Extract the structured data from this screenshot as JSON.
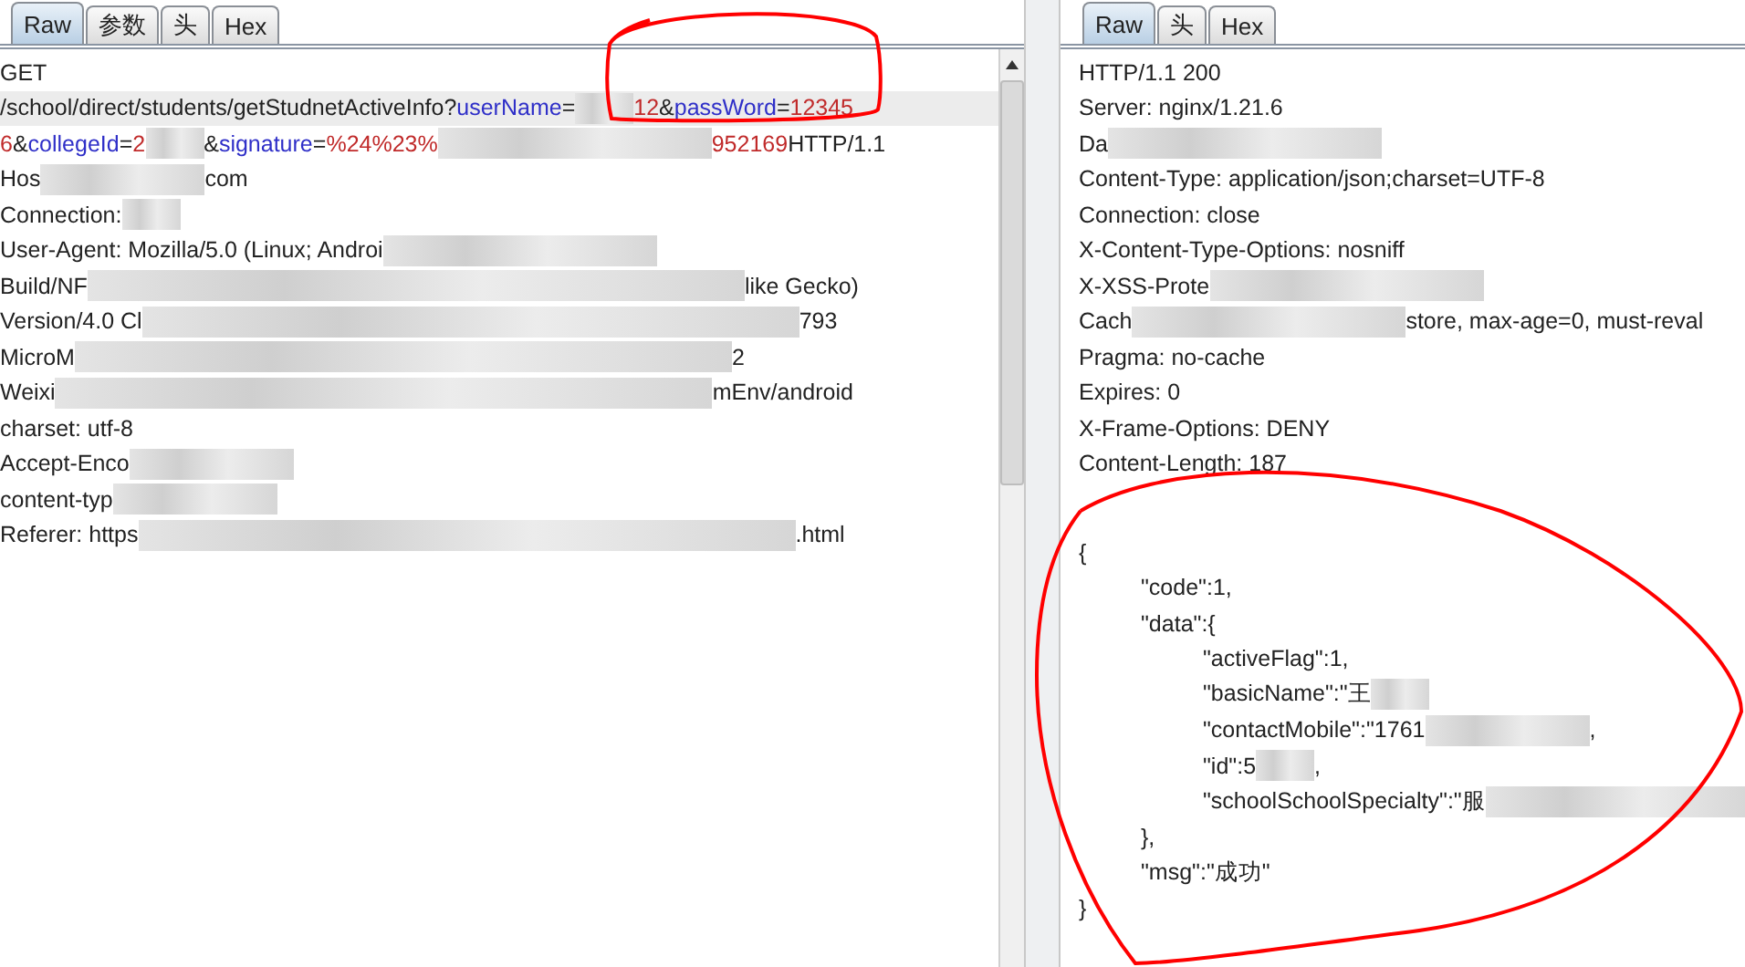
{
  "request": {
    "tabs": [
      {
        "label": "Raw",
        "selected": true
      },
      {
        "label": "参数",
        "selected": false
      },
      {
        "label": "头",
        "selected": false
      },
      {
        "label": "Hex",
        "selected": false
      }
    ],
    "lines": [
      {
        "highlighted": false,
        "segments": [
          {
            "kind": "plain",
            "text": "GET"
          }
        ]
      },
      {
        "highlighted": true,
        "segments": [
          {
            "kind": "plain",
            "text": "/school/direct/students/getStudnetActiveInfo?"
          },
          {
            "kind": "param",
            "text": "userName"
          },
          {
            "kind": "plain",
            "text": "="
          },
          {
            "kind": "blur-s"
          },
          {
            "kind": "value",
            "text": "12"
          },
          {
            "kind": "plain",
            "text": "&"
          },
          {
            "kind": "param",
            "text": "passWord"
          },
          {
            "kind": "plain",
            "text": "="
          },
          {
            "kind": "value",
            "text": "12345"
          }
        ]
      },
      {
        "highlighted": false,
        "segments": [
          {
            "kind": "value",
            "text": "6"
          },
          {
            "kind": "plain",
            "text": "&"
          },
          {
            "kind": "param",
            "text": "collegeId"
          },
          {
            "kind": "plain",
            "text": "="
          },
          {
            "kind": "value",
            "text": "2"
          },
          {
            "kind": "blur-s"
          },
          {
            "kind": "plain",
            "text": "&"
          },
          {
            "kind": "param",
            "text": "signature"
          },
          {
            "kind": "plain",
            "text": "="
          },
          {
            "kind": "value",
            "text": "%24%23%"
          },
          {
            "kind": "blur-l"
          },
          {
            "kind": "value",
            "text": "952169"
          },
          {
            "kind": "plain",
            "text": " HTTP/1.1"
          }
        ]
      },
      {
        "highlighted": false,
        "segments": [
          {
            "kind": "plain",
            "text": "Hos"
          },
          {
            "kind": "blur-m"
          },
          {
            "kind": "plain",
            "text": "com"
          }
        ]
      },
      {
        "highlighted": false,
        "segments": [
          {
            "kind": "plain",
            "text": "Connection:"
          },
          {
            "kind": "blur-s"
          }
        ]
      },
      {
        "highlighted": false,
        "segments": [
          {
            "kind": "plain",
            "text": "User-Agent: Mozilla/5.0 (Linux; Androi"
          },
          {
            "kind": "blur-l"
          }
        ]
      },
      {
        "highlighted": false,
        "segments": [
          {
            "kind": "plain",
            "text": "Build/NF"
          },
          {
            "kind": "blur-xl"
          },
          {
            "kind": "plain",
            "text": "like Gecko)"
          }
        ]
      },
      {
        "highlighted": false,
        "segments": [
          {
            "kind": "plain",
            "text": "Version/4.0 Cl"
          },
          {
            "kind": "blur-xl"
          },
          {
            "kind": "plain",
            "text": "793"
          }
        ]
      },
      {
        "highlighted": false,
        "segments": [
          {
            "kind": "plain",
            "text": "MicroM"
          },
          {
            "kind": "blur-xl"
          },
          {
            "kind": "plain",
            "text": "2"
          }
        ]
      },
      {
        "highlighted": false,
        "segments": [
          {
            "kind": "plain",
            "text": "Weixi"
          },
          {
            "kind": "blur-xl"
          },
          {
            "kind": "plain",
            "text": "mEnv/android"
          }
        ]
      },
      {
        "highlighted": false,
        "segments": [
          {
            "kind": "plain",
            "text": "charset: utf-8"
          }
        ]
      },
      {
        "highlighted": false,
        "segments": [
          {
            "kind": "plain",
            "text": "Accept-Enco"
          },
          {
            "kind": "blur-m"
          }
        ]
      },
      {
        "highlighted": false,
        "segments": [
          {
            "kind": "plain",
            "text": "content-typ"
          },
          {
            "kind": "blur-m"
          }
        ]
      },
      {
        "highlighted": false,
        "segments": [
          {
            "kind": "plain",
            "text": "Referer: https"
          },
          {
            "kind": "blur-xl"
          },
          {
            "kind": "plain",
            "text": ".html"
          }
        ]
      }
    ]
  },
  "response": {
    "tabs": [
      {
        "label": "Raw",
        "selected": true
      },
      {
        "label": "头",
        "selected": false
      },
      {
        "label": "Hex",
        "selected": false
      }
    ],
    "headers": [
      {
        "segments": [
          {
            "kind": "plain",
            "text": "HTTP/1.1 200"
          }
        ]
      },
      {
        "segments": [
          {
            "kind": "plain",
            "text": "Server: nginx/1.21.6"
          }
        ]
      },
      {
        "segments": [
          {
            "kind": "plain",
            "text": "Da"
          },
          {
            "kind": "blur-l"
          }
        ]
      },
      {
        "segments": [
          {
            "kind": "plain",
            "text": "Content-Type: application/json;charset=UTF-8"
          }
        ]
      },
      {
        "segments": [
          {
            "kind": "plain",
            "text": "Connection: close"
          }
        ]
      },
      {
        "segments": [
          {
            "kind": "plain",
            "text": "X-Content-Type-Options: nosniff"
          }
        ]
      },
      {
        "segments": [
          {
            "kind": "plain",
            "text": "X-XSS-Prote"
          },
          {
            "kind": "blur-l"
          }
        ]
      },
      {
        "segments": [
          {
            "kind": "plain",
            "text": "Cach"
          },
          {
            "kind": "blur-l"
          },
          {
            "kind": "plain",
            "text": "store, max-age=0, must-reval"
          }
        ]
      },
      {
        "segments": [
          {
            "kind": "plain",
            "text": "Pragma: no-cache"
          }
        ]
      },
      {
        "segments": [
          {
            "kind": "plain",
            "text": "Expires: 0"
          }
        ]
      },
      {
        "segments": [
          {
            "kind": "plain",
            "text": "X-Frame-Options: DENY"
          }
        ]
      },
      {
        "segments": [
          {
            "kind": "plain",
            "text": "Content-Length: 187"
          }
        ]
      }
    ],
    "body": [
      {
        "segments": [
          {
            "kind": "plain",
            "text": "{"
          }
        ],
        "children": [
          {
            "segments": [
              {
                "kind": "plain",
                "text": "\"code\":1,"
              }
            ]
          },
          {
            "segments": [
              {
                "kind": "plain",
                "text": "\"data\":{"
              }
            ],
            "children": [
              {
                "segments": [
                  {
                    "kind": "plain",
                    "text": "\"activeFlag\":1,"
                  }
                ]
              },
              {
                "segments": [
                  {
                    "kind": "plain",
                    "text": "\"basicName\":\"王"
                  },
                  {
                    "kind": "blur-s"
                  }
                ]
              },
              {
                "segments": [
                  {
                    "kind": "plain",
                    "text": "\"contactMobile\":\"1761"
                  },
                  {
                    "kind": "blur-m"
                  },
                  {
                    "kind": "plain",
                    "text": ","
                  }
                ]
              },
              {
                "segments": [
                  {
                    "kind": "plain",
                    "text": "\"id\":5"
                  },
                  {
                    "kind": "blur-s"
                  },
                  {
                    "kind": "plain",
                    "text": ","
                  }
                ]
              },
              {
                "segments": [
                  {
                    "kind": "plain",
                    "text": "\"schoolSchoolSpecialty\":\"服"
                  },
                  {
                    "kind": "blur-l"
                  }
                ]
              }
            ]
          },
          {
            "segments": [
              {
                "kind": "plain",
                "text": "},"
              }
            ]
          },
          {
            "segments": [
              {
                "kind": "plain",
                "text": "\"msg\":\"成功\""
              }
            ]
          }
        ]
      },
      {
        "segments": [
          {
            "kind": "plain",
            "text": "}"
          }
        ]
      }
    ]
  },
  "annotations": [
    {
      "kind": "ellipse",
      "color": "#ff0000"
    },
    {
      "kind": "loop",
      "color": "#ff0000"
    }
  ]
}
